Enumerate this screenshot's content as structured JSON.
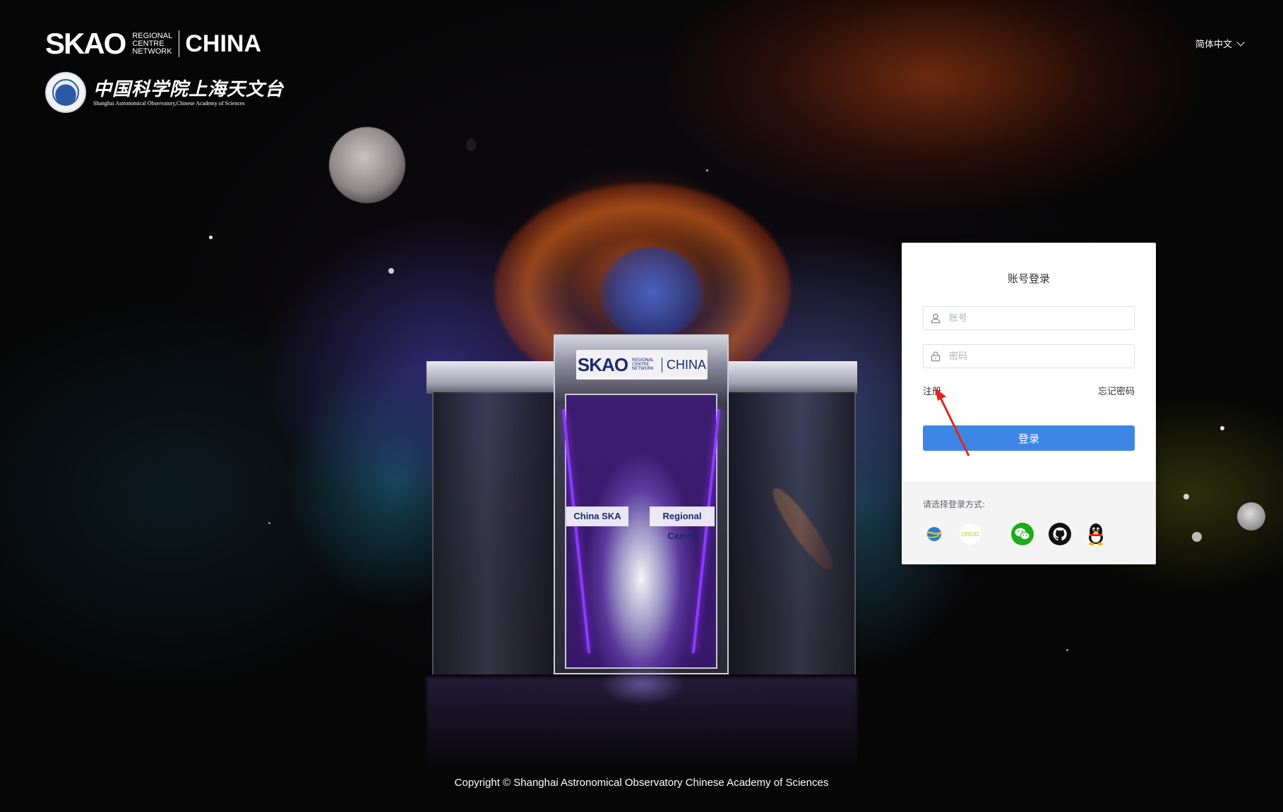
{
  "header": {
    "skao_logo": {
      "mark": "SKAO",
      "network_line1": "REGIONAL",
      "network_line2": "CENTRE",
      "network_line3": "NETWORK",
      "region": "CHINA"
    },
    "sao_logo": {
      "name_cn": "中国科学院上海天文台",
      "name_en": "Shanghai Astronomical Observatory,Chinese Academy of Sciences"
    },
    "language": {
      "selected": "简体中文",
      "icon": "chevron-down-icon"
    }
  },
  "scene": {
    "sign_mark": "SKAO",
    "sign_network": "REGIONAL CENTRE NETWORK",
    "sign_region": "CHINA",
    "banner_left": "China SKA",
    "banner_right": "Regional Centre"
  },
  "login": {
    "title": "账号登录",
    "account_placeholder": "账号",
    "password_placeholder": "密码",
    "register_link": "注册",
    "forgot_link": "忘记密码",
    "submit_label": "登录",
    "alt_methods_label": "请选择登录方式:",
    "providers": [
      {
        "name": "CSTNET",
        "icon": "globe-icon"
      },
      {
        "name": "ORCID",
        "icon": "orcid-icon"
      },
      {
        "name": "WeChat",
        "icon": "wechat-icon"
      },
      {
        "name": "GitHub",
        "icon": "github-icon"
      },
      {
        "name": "QQ",
        "icon": "qq-penguin-icon"
      }
    ],
    "orcid_text": "ORCiD"
  },
  "footer": {
    "copyright": "Copyright © Shanghai Astronomical Observatory Chinese Academy of Sciences"
  },
  "colors": {
    "primary_button": "#3e86e5",
    "wechat": "#1aad19",
    "annotation_arrow": "#e8231c"
  }
}
